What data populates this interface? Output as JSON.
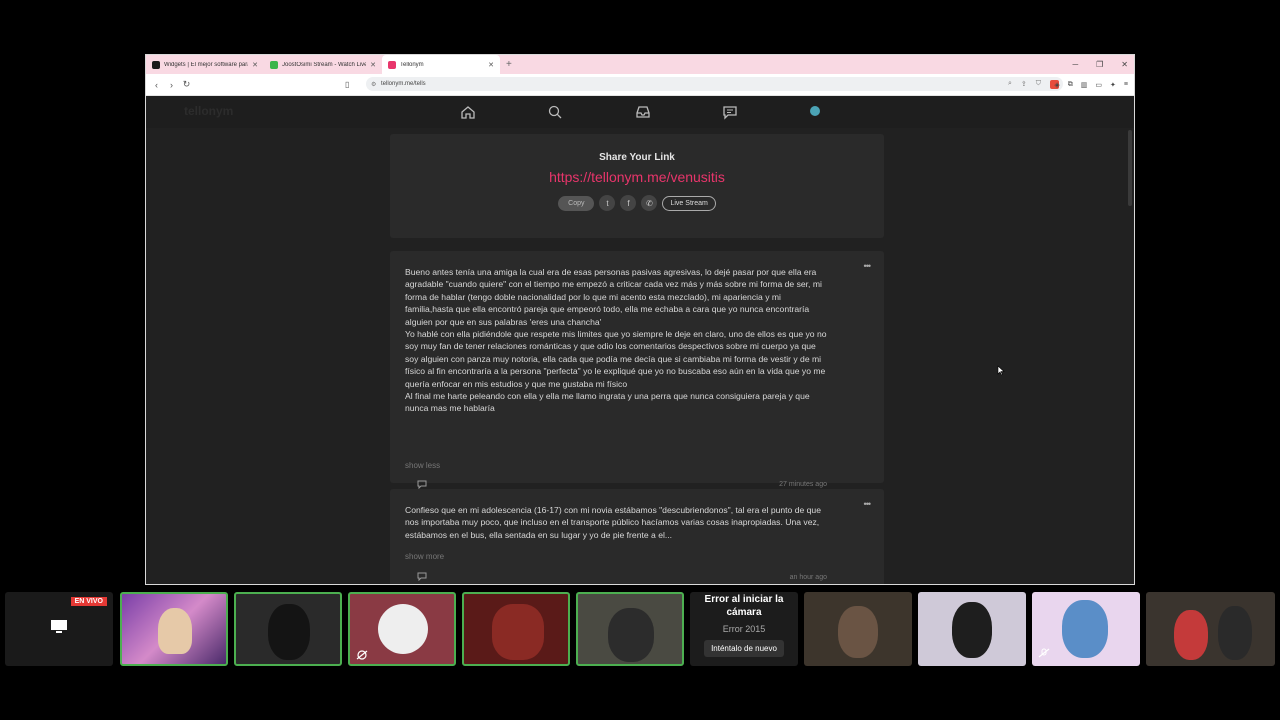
{
  "browser": {
    "tabs": [
      {
        "title": "Widgets | El mejor software para po",
        "color": "#1a1a1a",
        "active": false
      },
      {
        "title": "JoostOsimi Stream - Watch Live",
        "color": "#3bb54a",
        "active": false
      },
      {
        "title": "Tellonym",
        "color": "#e8356b",
        "active": true
      }
    ],
    "new_tab": "+",
    "url": "tellonym.me/tells"
  },
  "site": {
    "logo": "tellonym"
  },
  "share": {
    "title": "Share Your Link",
    "link": "https://tellonym.me/venusitis",
    "copy_label": "Copy",
    "live_label": "Live Stream"
  },
  "posts": [
    {
      "text": "Bueno antes tenía una amiga la cual era de esas personas pasivas agresivas, lo dejé pasar por que ella era agradable \"cuando quiere\" con el tiempo me empezó a criticar cada vez más y más sobre mi forma de ser, mi forma de hablar (tengo doble nacionalidad por lo que mi acento esta mezclado), mi apariencia y mi familia,hasta que ella encontró pareja que empeoró todo, ella me echaba a cara que yo nunca encontraría alguien por que en sus palabras 'eres una chancha'\nYo hablé con ella pidiéndole que respete mis limites que yo siempre le deje en claro, uno de ellos es que yo no soy muy fan de tener relaciones románticas y que odio los comentarios despectivos sobre mi cuerpo ya que soy alguien con panza muy notoria, ella cada que podía me decía que si cambiaba mi forma de vestir y de mi físico al fin encontraría a la persona \"perfecta\" yo le expliqué que yo no buscaba eso aún en la vida que yo me quería enfocar en mis estudios y que me gustaba mi físico\nAl final me harte peleando con ella y ella me llamo ingrata y una perra que nunca consiguiera pareja y que nunca mas me hablaría",
      "toggle": "show less",
      "time": "27 minutes ago"
    },
    {
      "text": "Confieso que en mi adolescencia (16-17) con mi novia estábamos \"descubriendonos\", tal era el punto de que nos importaba muy poco, que incluso en el transporte público hacíamos varias cosas inapropiadas. Una vez, estábamos en el bus, ella sentada en su lugar y yo de pie frente a el...",
      "toggle": "show more",
      "time": "an hour ago"
    }
  ],
  "stream_tiles": {
    "live_badge": "EN VIVO",
    "error_title": "Error al iniciar la cámara",
    "error_code": "Error 2015",
    "retry_label": "Inténtalo de nuevo"
  }
}
